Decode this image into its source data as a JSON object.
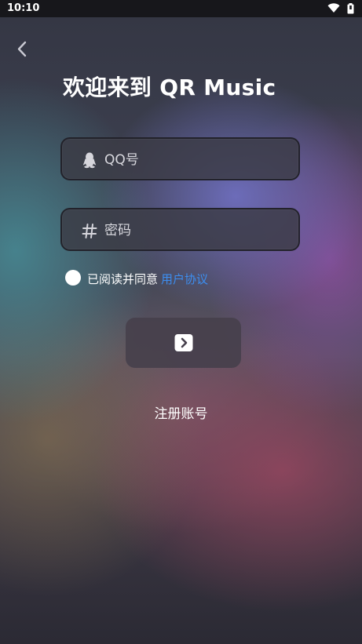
{
  "status_bar": {
    "time": "10:10",
    "icons": [
      "wifi-icon",
      "battery-icon"
    ]
  },
  "nav": {
    "back_icon": "chevron-left-icon"
  },
  "page": {
    "title": "欢迎来到 QR Music"
  },
  "form": {
    "qq_placeholder": "QQ号",
    "qq_value": "",
    "qq_icon": "qq-penguin-icon",
    "password_placeholder": "密码",
    "password_value": "",
    "password_icon": "hash-icon"
  },
  "agreement": {
    "checked": false,
    "text": "已阅读并同意",
    "link": "用户协议"
  },
  "login_button": {
    "icon": "arrow-right-box-icon"
  },
  "register": {
    "label": "注册账号"
  },
  "colors": {
    "link": "#3d8ef0",
    "text": "#ffffff",
    "status_bar": "#17171b"
  }
}
